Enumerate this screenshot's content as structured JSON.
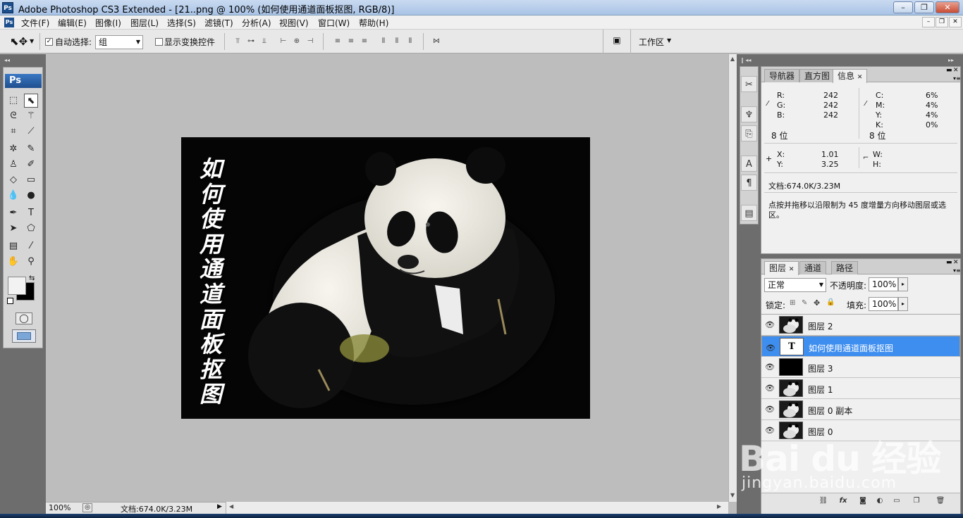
{
  "window": {
    "title": "Adobe Photoshop CS3 Extended - [21..png @ 100% (如何使用通道面板抠图, RGB/8)]",
    "app_icon": "Ps"
  },
  "menu": [
    "文件(F)",
    "编辑(E)",
    "图像(I)",
    "图层(L)",
    "选择(S)",
    "滤镜(T)",
    "分析(A)",
    "视图(V)",
    "窗口(W)",
    "帮助(H)"
  ],
  "options": {
    "auto_select_label": "自动选择:",
    "auto_select_value": "组",
    "show_transform_label": "显示变换控件",
    "workspace_label": "工作区"
  },
  "toolbox": {
    "logo": "Ps"
  },
  "canvas": {
    "vertical_text": "如何使用通道面板抠图"
  },
  "status": {
    "zoom": "100%",
    "doc": "文档:674.0K/3.23M"
  },
  "info_panel": {
    "tabs": [
      "导航器",
      "直方图",
      "信息"
    ],
    "active_tab": "信息",
    "rgb": {
      "r_label": "R:",
      "g_label": "G:",
      "b_label": "B:",
      "r": "242",
      "g": "242",
      "b": "242",
      "bits": "8 位"
    },
    "cmyk": {
      "c_label": "C:",
      "m_label": "M:",
      "y_label": "Y:",
      "k_label": "K:",
      "c": "6%",
      "m": "4%",
      "y": "4%",
      "k": "0%",
      "bits": "8 位"
    },
    "pos": {
      "x_label": "X:",
      "y_label": "Y:",
      "x": "1.01",
      "y": "3.25"
    },
    "size": {
      "w_label": "W:",
      "h_label": "H:"
    },
    "doc": "文档:674.0K/3.23M",
    "hint": "点按并拖移以沿限制为 45 度增量方向移动图层或选区。"
  },
  "layers_panel": {
    "tabs": [
      "图层",
      "通道",
      "路径"
    ],
    "blend_mode": "正常",
    "opacity_label": "不透明度:",
    "opacity": "100%",
    "lock_label": "锁定:",
    "fill_label": "填充:",
    "fill": "100%",
    "layers": [
      {
        "name": "图层 2",
        "thumb": "panda"
      },
      {
        "name": "如何使用通道面板抠图",
        "thumb": "text",
        "thumb_label": "T",
        "selected": true
      },
      {
        "name": "图层 3",
        "thumb": "black"
      },
      {
        "name": "图层 1",
        "thumb": "panda"
      },
      {
        "name": "图层 0 副本",
        "thumb": "panda"
      },
      {
        "name": "图层 0",
        "thumb": "panda"
      }
    ]
  },
  "watermark": {
    "brand": "Bai du 经验",
    "url": "jingyan.baidu.com"
  }
}
